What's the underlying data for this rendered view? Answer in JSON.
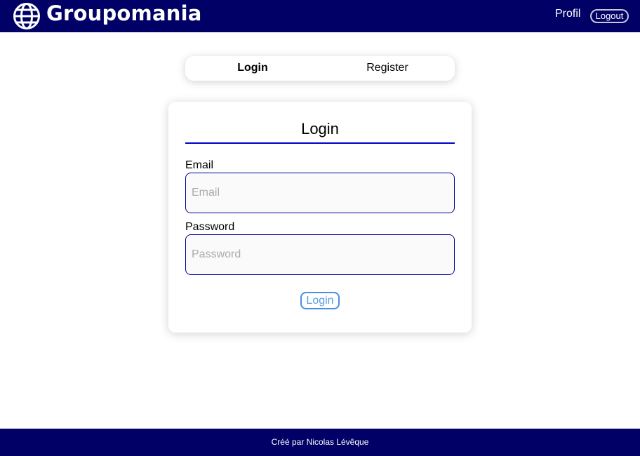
{
  "header": {
    "brand": "Groupomania",
    "brand_icon": "globe-icon",
    "nav": {
      "profil_label": "Profil",
      "logout_label": "Logout"
    }
  },
  "tabs": {
    "login_label": "Login",
    "register_label": "Register",
    "active": "Login"
  },
  "form": {
    "title": "Login",
    "email": {
      "label": "Email",
      "placeholder": "Email",
      "value": ""
    },
    "password": {
      "label": "Password",
      "placeholder": "Password",
      "value": ""
    },
    "submit_label": "Login"
  },
  "footer": {
    "text": "Créé par Nicolas Lévêque"
  },
  "colors": {
    "brand_navy": "#000066",
    "accent_blue": "#0000cc",
    "button_blue": "#4a8fe0"
  }
}
